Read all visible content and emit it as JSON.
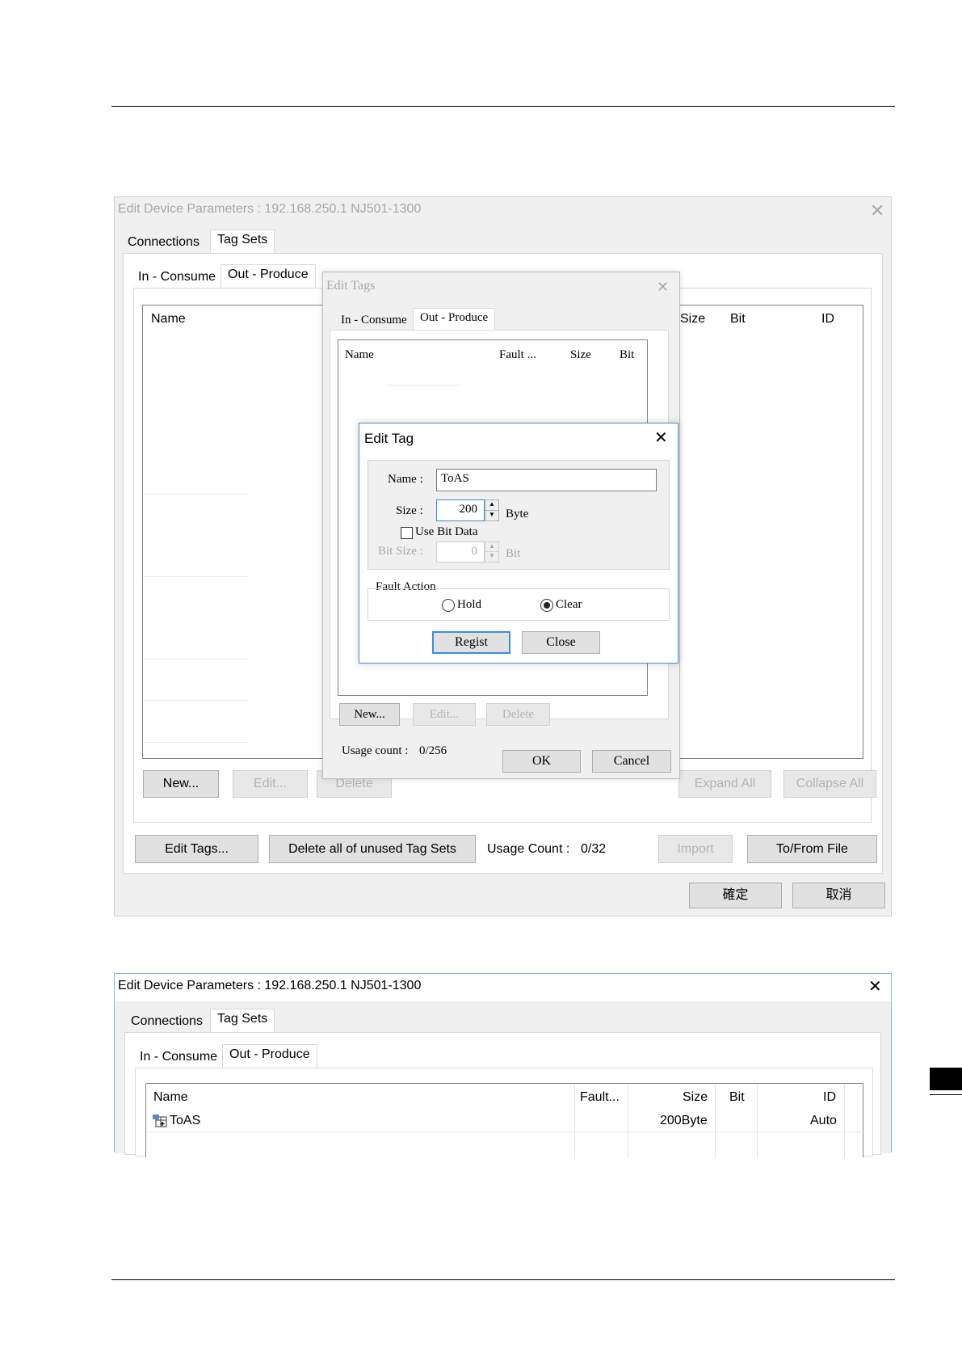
{
  "screenshot1": {
    "window_title": "Edit Device Parameters : 192.168.250.1 NJ501-1300",
    "tabs": [
      "Connections",
      "Tag Sets"
    ],
    "subtabs": [
      "In - Consume",
      "Out - Produce"
    ],
    "columns": [
      "Name",
      "Size",
      "Bit",
      "ID"
    ],
    "buttons": {
      "new": "New...",
      "edit": "Edit...",
      "delete": "Delete",
      "expand_all": "Expand All",
      "collapse_all": "Collapse All",
      "edit_tags": "Edit Tags...",
      "delete_unused": "Delete all of unused Tag Sets",
      "import": "Import",
      "to_from_file": "To/From File",
      "ok": "確定",
      "cancel": "取消"
    },
    "usage_count_label": "Usage Count :",
    "usage_count_value": "0/32",
    "edit_tags_dialog": {
      "title": "Edit Tags",
      "tabs": [
        "In - Consume",
        "Out - Produce"
      ],
      "columns": [
        "Name",
        "Fault ...",
        "Size",
        "Bit"
      ],
      "buttons": {
        "new": "New...",
        "edit": "Edit...",
        "delete": "Delete",
        "ok": "OK",
        "cancel": "Cancel"
      },
      "usage_count_label": "Usage count :",
      "usage_count_value": "0/256"
    },
    "edit_tag_dialog": {
      "title": "Edit Tag",
      "name_label": "Name :",
      "name_value": "ToAS",
      "size_label": "Size :",
      "size_value": "200",
      "size_unit": "Byte",
      "use_bit_data_label": "Use Bit Data",
      "use_bit_data_checked": false,
      "bit_size_label": "Bit Size :",
      "bit_size_value": "0",
      "bit_unit": "Bit",
      "fault_action_label": "Fault Action",
      "fault_options": [
        "Hold",
        "Clear"
      ],
      "fault_selected": "Clear",
      "regist_label": "Regist",
      "close_label": "Close"
    }
  },
  "screenshot2": {
    "window_title": "Edit Device Parameters : 192.168.250.1 NJ501-1300",
    "tabs": [
      "Connections",
      "Tag Sets"
    ],
    "subtabs": [
      "In - Consume",
      "Out - Produce"
    ],
    "columns": [
      "Name",
      "Fault...",
      "Size",
      "Bit",
      "ID"
    ],
    "rows": [
      {
        "name": "ToAS",
        "fault": "",
        "size": "200Byte",
        "bit": "",
        "id": "Auto"
      }
    ]
  },
  "icons": {
    "close": "close-icon",
    "tag_set": "tag-set-icon",
    "spin_up": "spin-up-icon",
    "spin_down": "spin-down-icon"
  }
}
